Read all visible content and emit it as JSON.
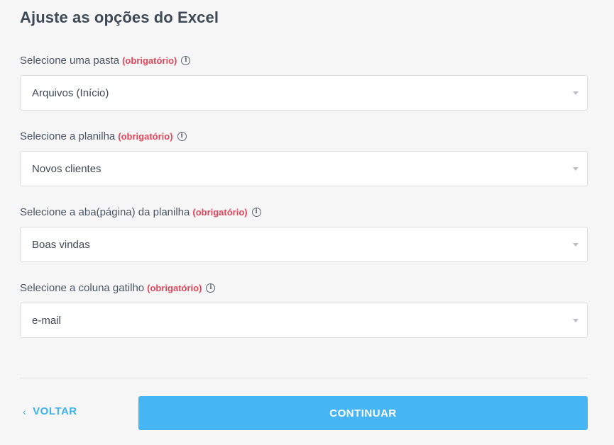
{
  "title": "Ajuste as opções do Excel",
  "required_text": "(obrigatório)",
  "fields": [
    {
      "label": "Selecione uma pasta",
      "value": "Arquivos (Início)"
    },
    {
      "label": "Selecione a planilha",
      "value": "Novos clientes"
    },
    {
      "label": "Selecione a aba(página) da planilha",
      "value": "Boas vindas"
    },
    {
      "label": "Selecione a coluna gatilho",
      "value": "e-mail"
    }
  ],
  "footer": {
    "back_label": "VOLTAR",
    "continue_label": "CONTINUAR"
  },
  "colors": {
    "accent": "#45b6f3",
    "required": "#e0475b",
    "background": "#f6f6f6"
  }
}
